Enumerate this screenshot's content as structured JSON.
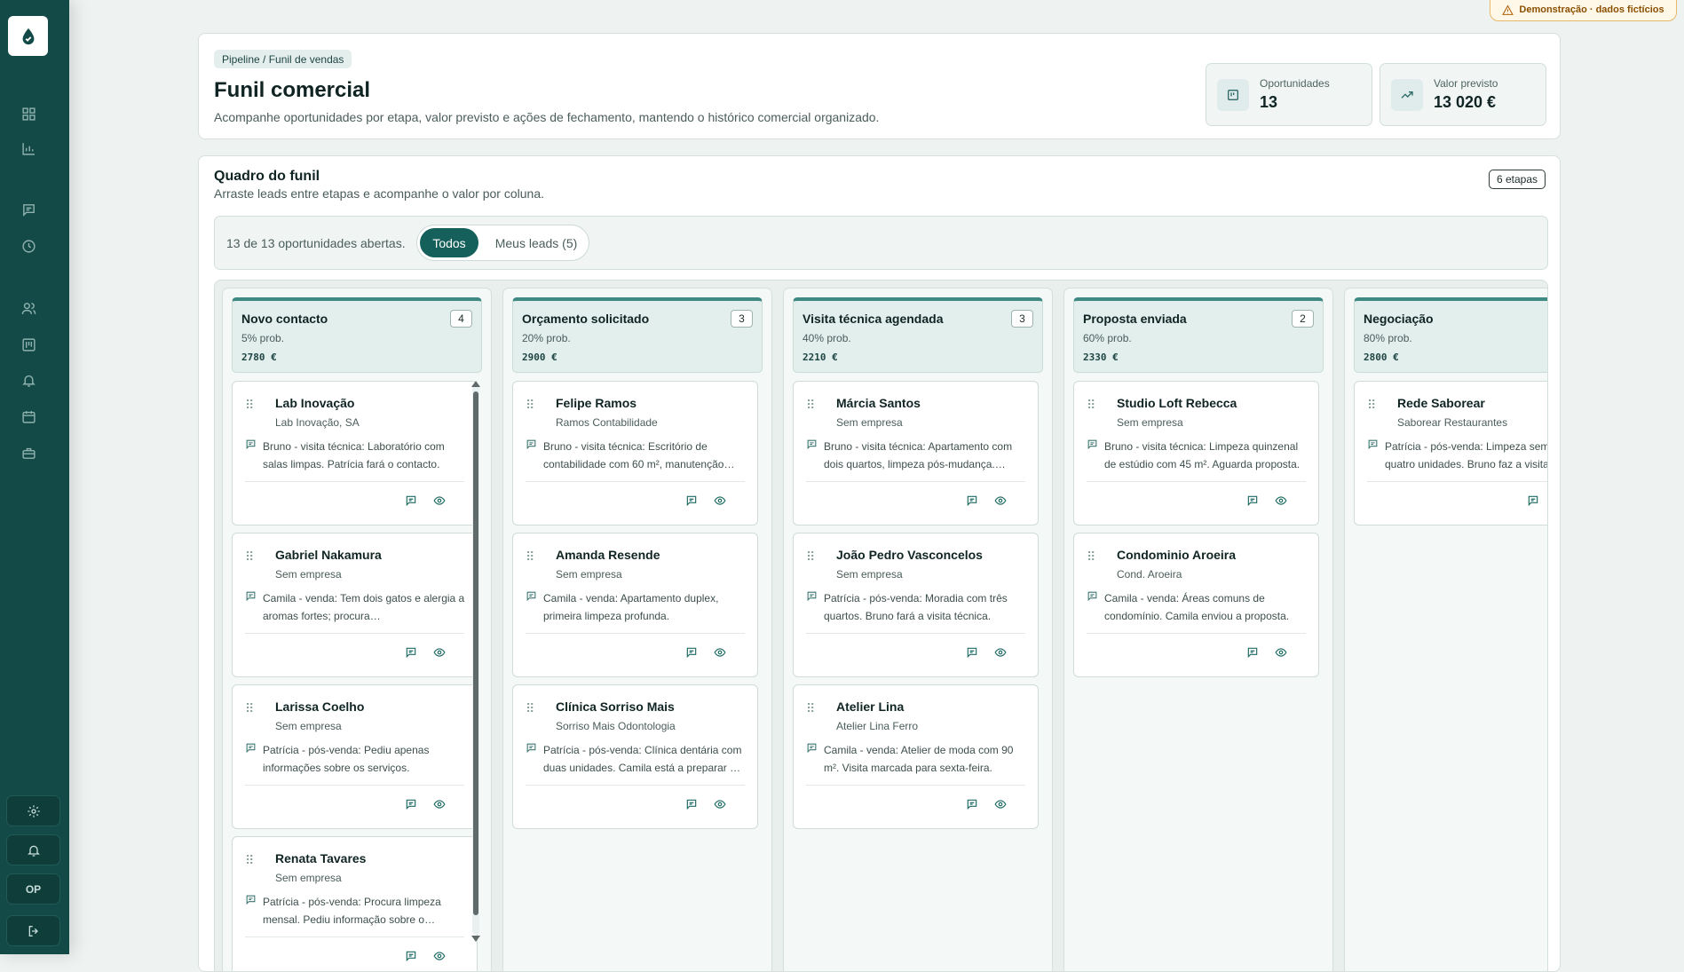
{
  "demo_badge": "Demonstração · dados fictícios",
  "sidebar": {
    "nav": [
      {
        "icon": "dashboard-icon"
      },
      {
        "icon": "bar-chart-icon"
      },
      {
        "icon": "message-icon"
      },
      {
        "icon": "clock-icon"
      },
      {
        "icon": "users-icon"
      },
      {
        "icon": "pipeline-icon"
      },
      {
        "icon": "bell-icon"
      },
      {
        "icon": "calendar-icon"
      },
      {
        "icon": "briefcase-icon"
      }
    ],
    "bottom": [
      {
        "icon": "gear-icon"
      },
      {
        "icon": "bell-icon"
      },
      {
        "label": "OP"
      },
      {
        "icon": "logout-icon"
      }
    ]
  },
  "header": {
    "breadcrumb": "Pipeline / Funil de vendas",
    "title": "Funil comercial",
    "subtitle": "Acompanhe oportunidades por etapa, valor previsto e ações de fechamento, mantendo o histórico comercial organizado.",
    "stats": [
      {
        "label": "Oportunidades",
        "value": "13",
        "icon": "kanban-icon"
      },
      {
        "label": "Valor previsto",
        "value": "13 020 €",
        "icon": "trending-up-icon"
      }
    ]
  },
  "board": {
    "title": "Quadro do funil",
    "subtitle": "Arraste leads entre etapas e acompanhe o valor por coluna.",
    "stages_badge": "6 etapas",
    "filter_text": "13 de 13 oportunidades abertas.",
    "filters": [
      "Todos",
      "Meus leads (5)"
    ],
    "columns": [
      {
        "name": "Novo contacto",
        "prob": "5% prob.",
        "value": "2780 €",
        "count": "4",
        "leads": [
          {
            "name": "Lab Inovação",
            "company": "Lab Inovação, SA",
            "note": "Bruno - visita técnica: Laboratório com salas limpas. Patrícia fará o contacto."
          },
          {
            "name": "Gabriel Nakamura",
            "company": "Sem empresa",
            "note": "Camila - venda: Tem dois gatos e alergia a aromas fortes; procura…"
          },
          {
            "name": "Larissa Coelho",
            "company": "Sem empresa",
            "note": "Patrícia - pós-venda: Pediu apenas informações sobre os serviços."
          },
          {
            "name": "Renata Tavares",
            "company": "Sem empresa",
            "note": "Patrícia - pós-venda: Procura limpeza mensal. Pediu informação sobre o…"
          }
        ]
      },
      {
        "name": "Orçamento solicitado",
        "prob": "20% prob.",
        "value": "2900 €",
        "count": "3",
        "leads": [
          {
            "name": "Felipe Ramos",
            "company": "Ramos Contabilidade",
            "note": "Bruno - visita técnica: Escritório de contabilidade com 60 m², manutenção…"
          },
          {
            "name": "Amanda Resende",
            "company": "Sem empresa",
            "note": "Camila - venda: Apartamento duplex, primeira limpeza profunda."
          },
          {
            "name": "Clínica Sorriso Mais",
            "company": "Sorriso Mais Odontologia",
            "note": "Patrícia - pós-venda: Clínica dentária com duas unidades. Camila está a preparar …"
          }
        ]
      },
      {
        "name": "Visita técnica agendada",
        "prob": "40% prob.",
        "value": "2210 €",
        "count": "3",
        "leads": [
          {
            "name": "Márcia Santos",
            "company": "Sem empresa",
            "note": "Bruno - visita técnica: Apartamento com dois quartos, limpeza pós-mudança.…"
          },
          {
            "name": "João Pedro Vasconcelos",
            "company": "Sem empresa",
            "note": "Patrícia - pós-venda: Moradia com três quartos. Bruno fará a visita técnica."
          },
          {
            "name": "Atelier Lina",
            "company": "Atelier Lina Ferro",
            "note": "Camila - venda: Atelier de moda com 90 m². Visita marcada para sexta-feira."
          }
        ]
      },
      {
        "name": "Proposta enviada",
        "prob": "60% prob.",
        "value": "2330 €",
        "count": "2",
        "leads": [
          {
            "name": "Studio Loft Rebecca",
            "company": "Sem empresa",
            "note": "Bruno - visita técnica: Limpeza quinzenal de estúdio com 45 m². Aguarda proposta."
          },
          {
            "name": "Condominio Aroeira",
            "company": "Cond. Aroeira",
            "note": "Camila - venda: Áreas comuns de condomínio. Camila enviou a proposta."
          }
        ]
      },
      {
        "name": "Negociação",
        "prob": "80% prob.",
        "value": "2800 €",
        "count": "",
        "leads": [
          {
            "name": "Rede Saborear",
            "company": "Saborear Restaurantes",
            "note": "Patrícia - pós-venda: Limpeza semanal em quatro unidades. Bruno faz a visita…"
          }
        ]
      }
    ]
  },
  "colors": {
    "sidebar": "#134a47",
    "accent": "#16605b",
    "column_header": "#e2efed"
  }
}
